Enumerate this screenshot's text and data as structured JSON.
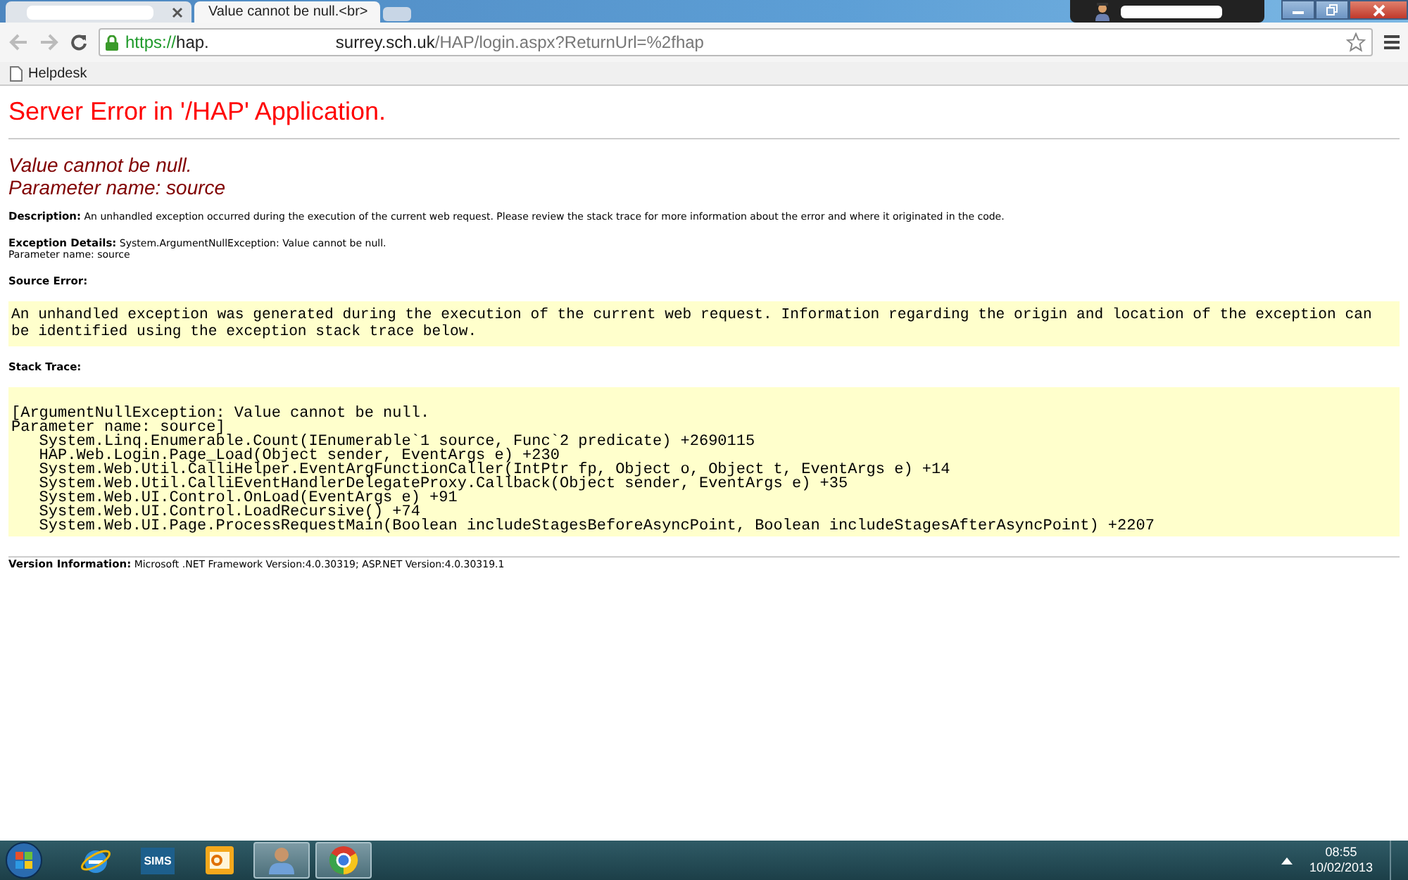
{
  "browser": {
    "tabs": [
      {
        "redacted": true,
        "selected": false
      },
      {
        "label": "Value cannot be null.<br>",
        "selected": true
      }
    ],
    "url": {
      "scheme": "https://",
      "host_start": "hap.",
      "host_end": "surrey.sch.uk",
      "path": "/HAP/login.aspx?ReturnUrl=%2fhap"
    },
    "bookmarks": [
      "Helpdesk"
    ]
  },
  "page": {
    "title": "Server Error in '/HAP' Application.",
    "error_message": [
      "Value cannot be null.",
      "Parameter name: source"
    ],
    "description": {
      "label": "Description:",
      "text": "An unhandled exception occurred during the execution of the current web request. Please review the stack trace for more information about the error and where it originated in the code."
    },
    "exception_details": {
      "label": "Exception Details:",
      "text": "System.ArgumentNullException: Value cannot be null.",
      "extra": "Parameter name: source"
    },
    "source_error": {
      "label": "Source Error:",
      "text": "An unhandled exception was generated during the execution of the current web request. Information regarding the origin and location of the exception can be identified using the exception stack trace below."
    },
    "stack_trace": {
      "label": "Stack Trace:",
      "lines": [
        "[ArgumentNullException: Value cannot be null.",
        "Parameter name: source]",
        "   System.Linq.Enumerable.Count(IEnumerable`1 source, Func`2 predicate) +2690115",
        "   HAP.Web.Login.Page_Load(Object sender, EventArgs e) +230",
        "   System.Web.Util.CalliHelper.EventArgFunctionCaller(IntPtr fp, Object o, Object t, EventArgs e) +14",
        "   System.Web.Util.CalliEventHandlerDelegateProxy.Callback(Object sender, EventArgs e) +35",
        "   System.Web.UI.Control.OnLoad(EventArgs e) +91",
        "   System.Web.UI.Control.LoadRecursive() +74",
        "   System.Web.UI.Page.ProcessRequestMain(Boolean includeStagesBeforeAsyncPoint, Boolean includeStagesAfterAsyncPoint) +2207"
      ]
    },
    "version": {
      "label": "Version Information:",
      "text": "Microsoft .NET Framework Version:4.0.30319; ASP.NET Version:4.0.30319.1"
    }
  },
  "taskbar": {
    "items": [
      {
        "kind": "ie",
        "open": false
      },
      {
        "kind": "sims",
        "label": "SIMS",
        "open": false
      },
      {
        "kind": "outlook",
        "open": false
      },
      {
        "kind": "user",
        "open": true
      },
      {
        "kind": "chrome",
        "open": true
      }
    ],
    "time": "08:55",
    "date": "10/02/2013"
  }
}
